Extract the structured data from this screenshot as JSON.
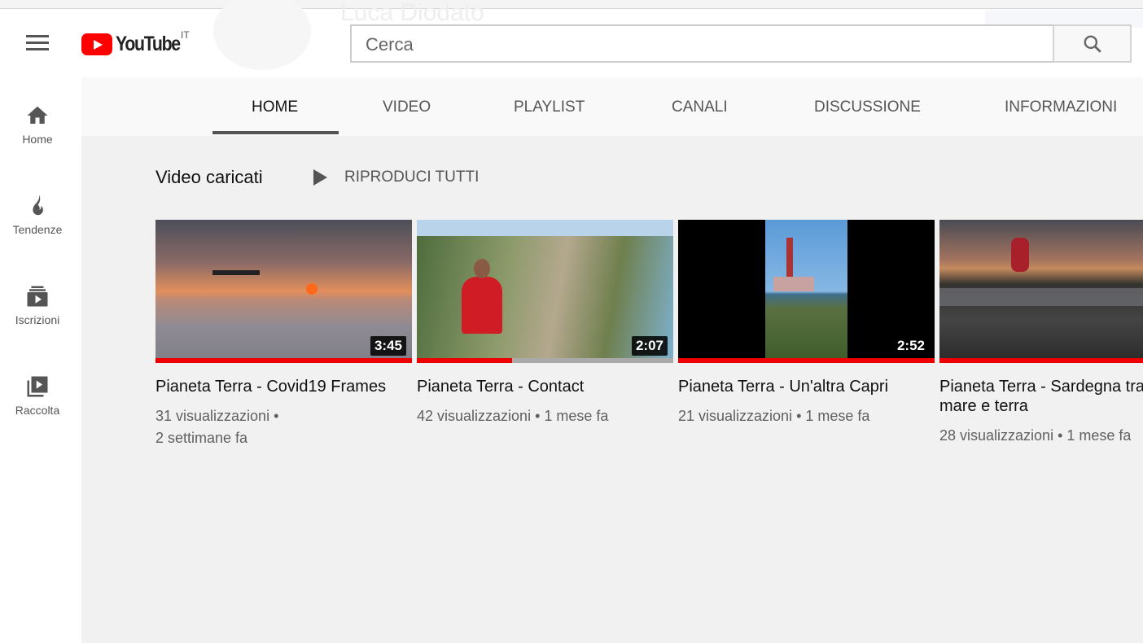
{
  "header": {
    "logo": "YouTube",
    "country": "IT",
    "search_placeholder": "Cerca",
    "channel_ghost": "Luca Diodato"
  },
  "sidebar": {
    "items": [
      {
        "label": "Home",
        "icon": "home-icon"
      },
      {
        "label": "Tendenze",
        "icon": "flame-icon"
      },
      {
        "label": "Iscrizioni",
        "icon": "subscriptions-icon"
      },
      {
        "label": "Raccolta",
        "icon": "library-icon"
      }
    ]
  },
  "tabs": [
    {
      "label": "HOME",
      "active": true
    },
    {
      "label": "VIDEO"
    },
    {
      "label": "PLAYLIST"
    },
    {
      "label": "CANALI"
    },
    {
      "label": "DISCUSSIONE"
    },
    {
      "label": "INFORMAZIONI"
    }
  ],
  "section": {
    "title": "Video caricati",
    "play_all": "RIPRODUCI TUTTI"
  },
  "videos": [
    {
      "title": "Pianeta Terra - Covid19 Frames",
      "views": "31 visualizzazioni",
      "age": "2 settimane fa",
      "duration": "3:45",
      "progress": 100
    },
    {
      "title": "Pianeta Terra - Contact",
      "views": "42 visualizzazioni",
      "age": "1 mese fa",
      "duration": "2:07",
      "progress": 37
    },
    {
      "title": "Pianeta Terra - Un'altra Capri",
      "views": "21 visualizzazioni",
      "age": "1 mese fa",
      "duration": "2:52",
      "progress": 100
    },
    {
      "title": "Pianeta Terra - Sardegna tra mare e terra",
      "views": "28 visualizzazioni",
      "age": "1 mese fa",
      "duration": "",
      "progress": 100
    }
  ],
  "colors": {
    "brand": "#ff0000",
    "progress": "#e00000"
  }
}
